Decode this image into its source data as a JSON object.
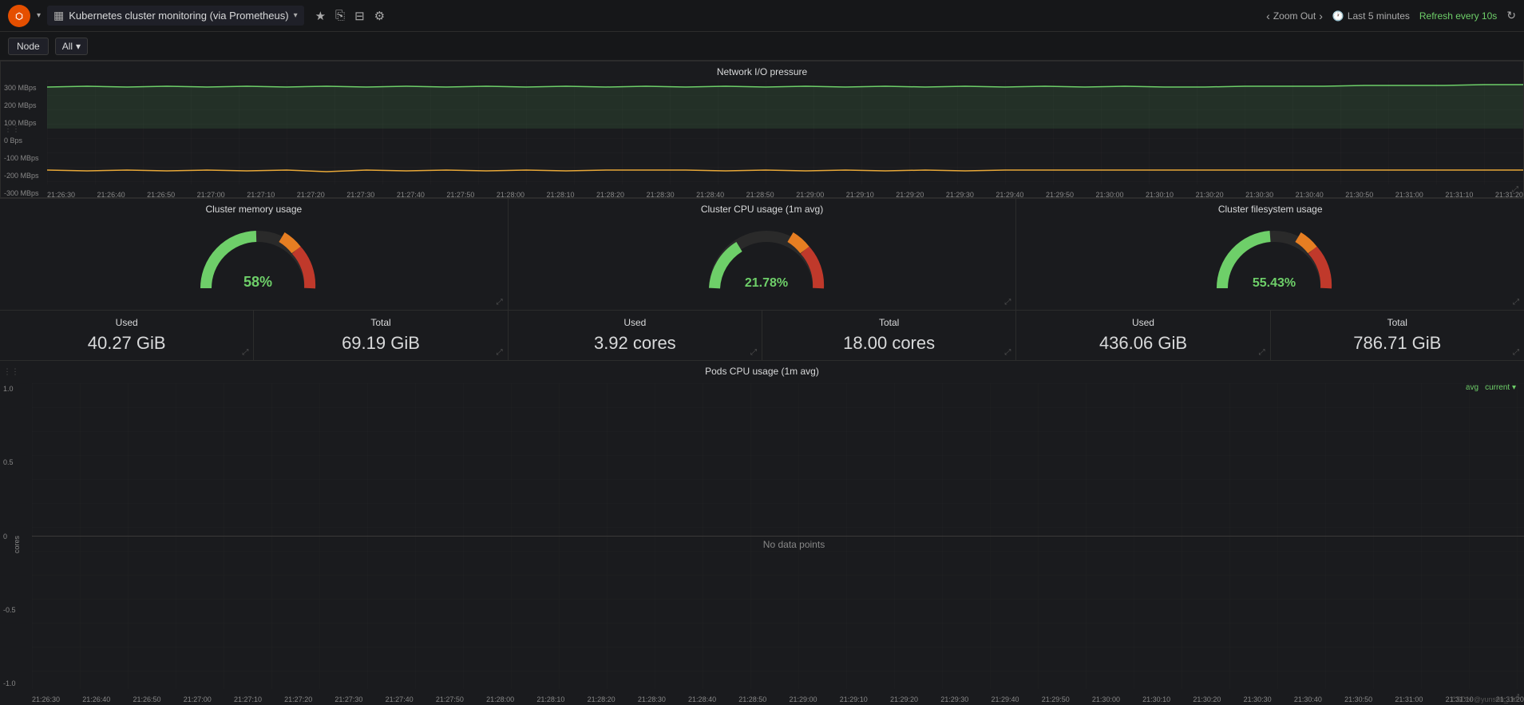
{
  "nav": {
    "logo": "⬡",
    "title": "Kubernetes cluster monitoring (via Prometheus)",
    "dropdown_arrow": "▾",
    "icons": [
      "★",
      "⎘",
      "⊟",
      "⚙"
    ],
    "zoom_out": "Zoom Out",
    "time_range": "Last 5 minutes",
    "refresh": "Refresh every 10s",
    "time_icon": "🕐"
  },
  "filter": {
    "node_label": "Node",
    "all_label": "All",
    "all_arrow": "▾"
  },
  "network_panel": {
    "title": "Network I/O pressure",
    "y_labels": [
      "300 MBps",
      "200 MBps",
      "100 MBps",
      "0 Bps",
      "-100 MBps",
      "-200 MBps",
      "-300 MBps"
    ],
    "x_labels": [
      "21:26:30",
      "21:26:40",
      "21:26:50",
      "21:27:00",
      "21:27:10",
      "21:27:20",
      "21:27:30",
      "21:27:40",
      "21:27:50",
      "21:28:00",
      "21:28:10",
      "21:28:20",
      "21:28:30",
      "21:28:40",
      "21:28:50",
      "21:29:00",
      "21:29:10",
      "21:29:20",
      "21:29:30",
      "21:29:40",
      "21:29:50",
      "21:30:00",
      "21:30:10",
      "21:30:20",
      "21:30:30",
      "21:30:40",
      "21:30:50",
      "21:31:00",
      "21:31:10",
      "21:31:20"
    ]
  },
  "memory_gauge": {
    "title": "Cluster memory usage",
    "value": "58%",
    "color": "#6ecf69"
  },
  "cpu_gauge": {
    "title": "Cluster CPU usage (1m avg)",
    "value": "21.78%",
    "color": "#6ecf69"
  },
  "fs_gauge": {
    "title": "Cluster filesystem usage",
    "value": "55.43%",
    "color": "#6ecf69"
  },
  "stats": {
    "memory_used_label": "Used",
    "memory_used_value": "40.27 GiB",
    "memory_total_label": "Total",
    "memory_total_value": "69.19 GiB",
    "cpu_used_label": "Used",
    "cpu_used_value": "3.92 cores",
    "cpu_total_label": "Total",
    "cpu_total_value": "18.00 cores",
    "fs_used_label": "Used",
    "fs_used_value": "436.06 GiB",
    "fs_total_label": "Total",
    "fs_total_value": "786.71 GiB"
  },
  "pods_panel": {
    "title": "Pods CPU usage (1m avg)",
    "no_data": "No data points",
    "y_labels": [
      "1.0",
      "0.5",
      "0",
      "-0.5",
      "-1.0"
    ],
    "y_axis_label": "cores",
    "x_labels": [
      "21:26:30",
      "21:26:40",
      "21:26:50",
      "21:27:00",
      "21:27:10",
      "21:27:20",
      "21:27:30",
      "21:27:40",
      "21:27:50",
      "21:28:00",
      "21:28:10",
      "21:28:20",
      "21:28:30",
      "21:28:40",
      "21:28:50",
      "21:29:00",
      "21:29:10",
      "21:29:20",
      "21:29:30",
      "21:29:40",
      "21:29:50",
      "21:30:00",
      "21:30:10",
      "21:30:20",
      "21:30:30",
      "21:30:40",
      "21:30:50",
      "21:31:00",
      "21:31:10",
      "21:31:20"
    ],
    "legend_avg": "avg",
    "legend_current": "current ▾"
  },
  "watermark": "CSDN @yunson_Liu"
}
